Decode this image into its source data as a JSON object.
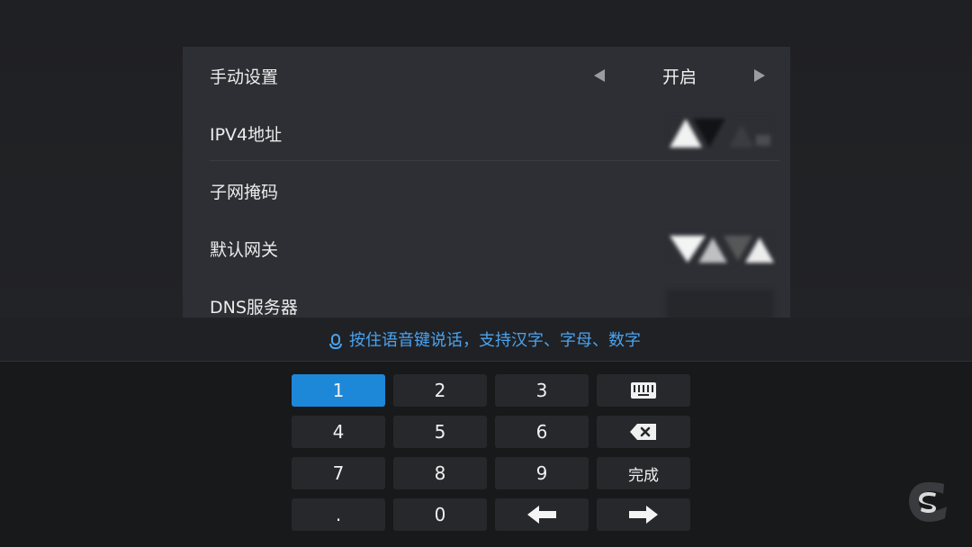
{
  "settings": {
    "manual": {
      "label": "手动设置",
      "value": "开启"
    },
    "ipv4": {
      "label": "IPV4地址"
    },
    "subnet": {
      "label": "子网掩码"
    },
    "gateway": {
      "label": "默认网关"
    },
    "dns": {
      "label": "DNS服务器"
    }
  },
  "keyboard": {
    "hint": "按住语音键说话，支持汉字、字母、数字",
    "keys": [
      "1",
      "2",
      "3",
      "4",
      "5",
      "6",
      "7",
      "8",
      "9",
      "完成",
      ".",
      "0"
    ],
    "icons": {
      "keyboard": "keyboard-icon",
      "backspace": "backspace-icon",
      "left": "arrow-left-icon",
      "right": "arrow-right-icon"
    },
    "active_color": "#1e88d8"
  },
  "colors": {
    "panel": "#2d2f34",
    "accent": "#4aa3f0"
  }
}
